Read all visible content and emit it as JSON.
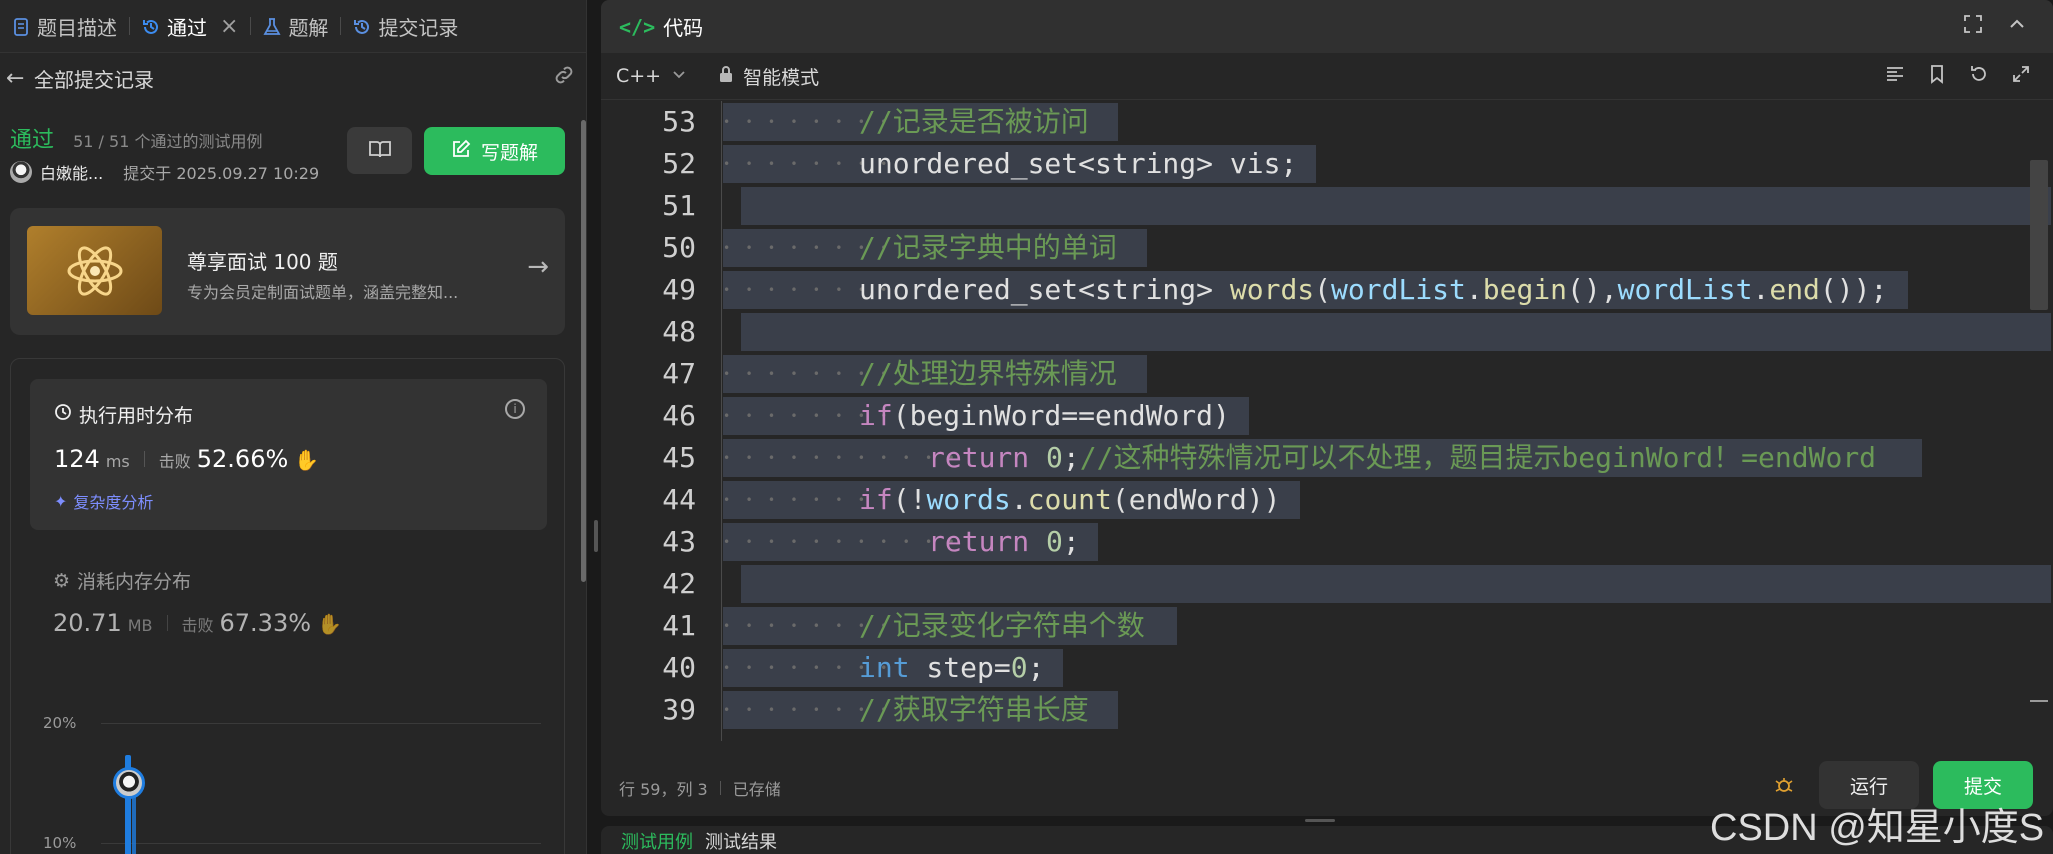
{
  "left": {
    "tabs": [
      {
        "label": "题目描述",
        "icon": "document-icon"
      },
      {
        "label": "通过",
        "icon": "history-icon",
        "active": true
      },
      {
        "label": "题解",
        "icon": "flask-icon"
      },
      {
        "label": "提交记录",
        "icon": "history-icon"
      }
    ],
    "close_label": "×",
    "back_title": "全部提交记录",
    "status": {
      "label": "通过",
      "cases": "51 / 51 个通过的测试用例"
    },
    "author": {
      "name": "白嫩能...",
      "submitted": "提交于 2025.09.27 10:29"
    },
    "write_button": "写题解",
    "promo": {
      "title": "尊享面试 100 题",
      "subtitle": "专为会员定制面试题单，涵盖完整知..."
    },
    "runtime": {
      "title": "执行用时分布",
      "value": "124",
      "unit": "ms",
      "beat_label": "击败",
      "beat_value": "52.66%",
      "complexity": "复杂度分析"
    },
    "memory": {
      "title": "消耗内存分布",
      "value": "20.71",
      "unit": "MB",
      "beat_label": "击败",
      "beat_value": "67.33%"
    },
    "chart": {
      "ticks": [
        "20%",
        "10%"
      ]
    }
  },
  "right": {
    "title": "代码",
    "language": "C++",
    "mode": "智能模式",
    "lines": [
      {
        "n": "53",
        "indent": 1,
        "parts": [
          [
            "c-cm",
            "//记录是否被访问"
          ]
        ]
      },
      {
        "n": "52",
        "indent": 1,
        "parts": [
          [
            "",
            "unordered_set<string> vis;"
          ]
        ]
      },
      {
        "n": "51",
        "indent": 0,
        "parts": []
      },
      {
        "n": "50",
        "indent": 1,
        "parts": [
          [
            "c-cm",
            "//记录字典中的单词"
          ]
        ]
      },
      {
        "n": "49",
        "indent": 1,
        "parts": [
          [
            "",
            "unordered_set<string> "
          ],
          [
            "c-fn",
            "words"
          ],
          [
            "",
            "("
          ],
          [
            "c-vr",
            "wordList"
          ],
          [
            "",
            "."
          ],
          [
            "c-fn",
            "begin"
          ],
          [
            "",
            "(),"
          ],
          [
            "c-vr",
            "wordList"
          ],
          [
            "",
            "."
          ],
          [
            "c-fn",
            "end"
          ],
          [
            "",
            "());"
          ]
        ]
      },
      {
        "n": "48",
        "indent": 0,
        "parts": []
      },
      {
        "n": "47",
        "indent": 1,
        "parts": [
          [
            "c-cm",
            "//处理边界特殊情况"
          ]
        ]
      },
      {
        "n": "46",
        "indent": 1,
        "parts": [
          [
            "c-kw",
            "if"
          ],
          [
            "",
            "(beginWord==endWord)"
          ]
        ]
      },
      {
        "n": "45",
        "indent": 2,
        "parts": [
          [
            "c-kw",
            "return"
          ],
          [
            "",
            " "
          ],
          [
            "c-nm",
            "0"
          ],
          [
            "",
            ";"
          ],
          [
            "c-cm",
            "//这种特殊情况可以不处理，题目提示beginWord！=endWord"
          ]
        ]
      },
      {
        "n": "44",
        "indent": 1,
        "parts": [
          [
            "c-kw",
            "if"
          ],
          [
            "",
            "(!"
          ],
          [
            "c-vr",
            "words"
          ],
          [
            "",
            "."
          ],
          [
            "c-fn",
            "count"
          ],
          [
            "",
            "(endWord))"
          ]
        ]
      },
      {
        "n": "43",
        "indent": 2,
        "parts": [
          [
            "c-kw",
            "return"
          ],
          [
            "",
            " "
          ],
          [
            "c-nm",
            "0"
          ],
          [
            "",
            ";"
          ]
        ]
      },
      {
        "n": "42",
        "indent": 0,
        "parts": []
      },
      {
        "n": "41",
        "indent": 1,
        "parts": [
          [
            "c-cm",
            "//记录变化字符串个数"
          ]
        ]
      },
      {
        "n": "40",
        "indent": 1,
        "parts": [
          [
            "c-ty",
            "int"
          ],
          [
            "",
            " step="
          ],
          [
            "c-nm",
            "0"
          ],
          [
            "",
            ";"
          ]
        ]
      },
      {
        "n": "39",
        "indent": 1,
        "parts": [
          [
            "c-cm",
            "//获取字符串长度"
          ]
        ]
      }
    ],
    "footer": {
      "position": "行 59，列 3",
      "saved": "已存储"
    },
    "run_button": "运行",
    "submit_button": "提交",
    "bottom_tabs": [
      "测试用例",
      "测试结果"
    ]
  },
  "watermark": "CSDN @知星小度S"
}
